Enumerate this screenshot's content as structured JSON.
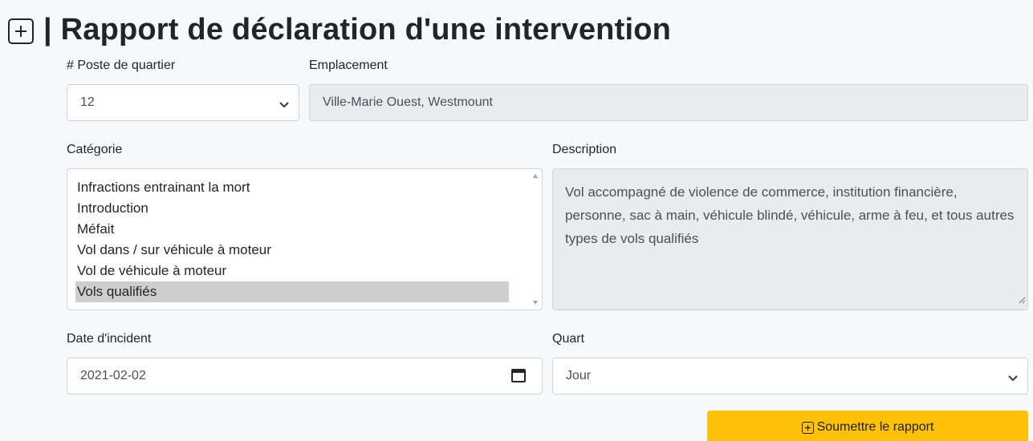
{
  "header": {
    "title": "Rapport de déclaration d'une intervention",
    "icon": "plus-square-icon"
  },
  "poste": {
    "label": "# Poste de quartier",
    "value": "12"
  },
  "emplacement": {
    "label": "Emplacement",
    "value": "Ville-Marie Ouest, Westmount"
  },
  "categorie": {
    "label": "Catégorie",
    "items": [
      "Infractions entrainant la mort",
      "Introduction",
      "Méfait",
      "Vol dans / sur véhicule à moteur",
      "Vol de véhicule à moteur",
      "Vols qualifiés"
    ],
    "selected": "Vols qualifiés"
  },
  "description": {
    "label": "Description",
    "value": "Vol accompagné de violence de commerce, institution financière, personne, sac à main, véhicule blindé, véhicule, arme à feu, et tous autres types de vols qualifiés"
  },
  "date": {
    "label": "Date d'incident",
    "value": "2021-02-02"
  },
  "quart": {
    "label": "Quart",
    "value": "Jour"
  },
  "submit": {
    "label": "Soumettre le rapport"
  },
  "colors": {
    "accent": "#ffc107",
    "disabled_bg": "#e9ecef",
    "selected_bg": "#cecece"
  }
}
